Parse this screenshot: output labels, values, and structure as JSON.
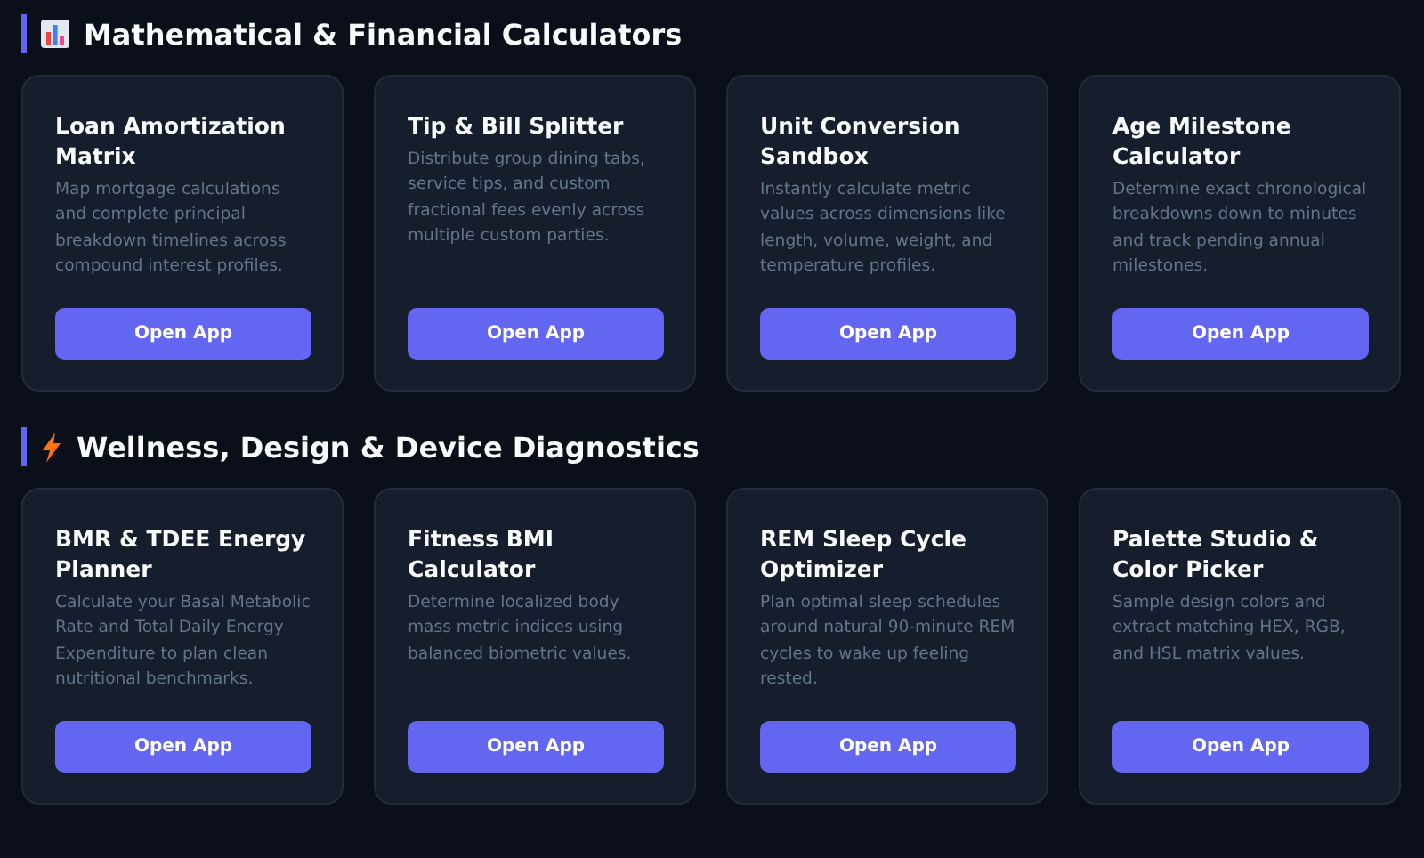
{
  "sections": [
    {
      "title": "Mathematical & Financial Calculators",
      "apps": [
        {
          "name": "Loan Amortization Matrix",
          "description": "Map mortgage calculations and complete principal breakdown timelines across compound interest profiles.",
          "button": "Open App"
        },
        {
          "name": "Tip & Bill Splitter",
          "description": "Distribute group dining tabs, service tips, and custom fractional fees evenly across multiple custom parties.",
          "button": "Open App"
        },
        {
          "name": "Unit Conversion Sandbox",
          "description": "Instantly calculate metric values across dimensions like length, volume, weight, and temperature profiles.",
          "button": "Open App"
        },
        {
          "name": "Age Milestone Calculator",
          "description": "Determine exact chronological breakdowns down to minutes and track pending annual milestones.",
          "button": "Open App"
        }
      ]
    },
    {
      "title": "Wellness, Design & Device Diagnostics",
      "apps": [
        {
          "name": "BMR & TDEE Energy Planner",
          "description": "Calculate your Basal Metabolic Rate and Total Daily Energy Expenditure to plan clean nutritional benchmarks.",
          "button": "Open App"
        },
        {
          "name": "Fitness BMI Calculator",
          "description": "Determine localized body mass metric indices using balanced biometric values.",
          "button": "Open App"
        },
        {
          "name": "REM Sleep Cycle Optimizer",
          "description": "Plan optimal sleep schedules around natural 90-minute REM cycles to wake up feeling rested.",
          "button": "Open App"
        },
        {
          "name": "Palette Studio & Color Picker",
          "description": "Sample design colors and extract matching HEX, RGB, and HSL matrix values.",
          "button": "Open App"
        }
      ]
    }
  ]
}
